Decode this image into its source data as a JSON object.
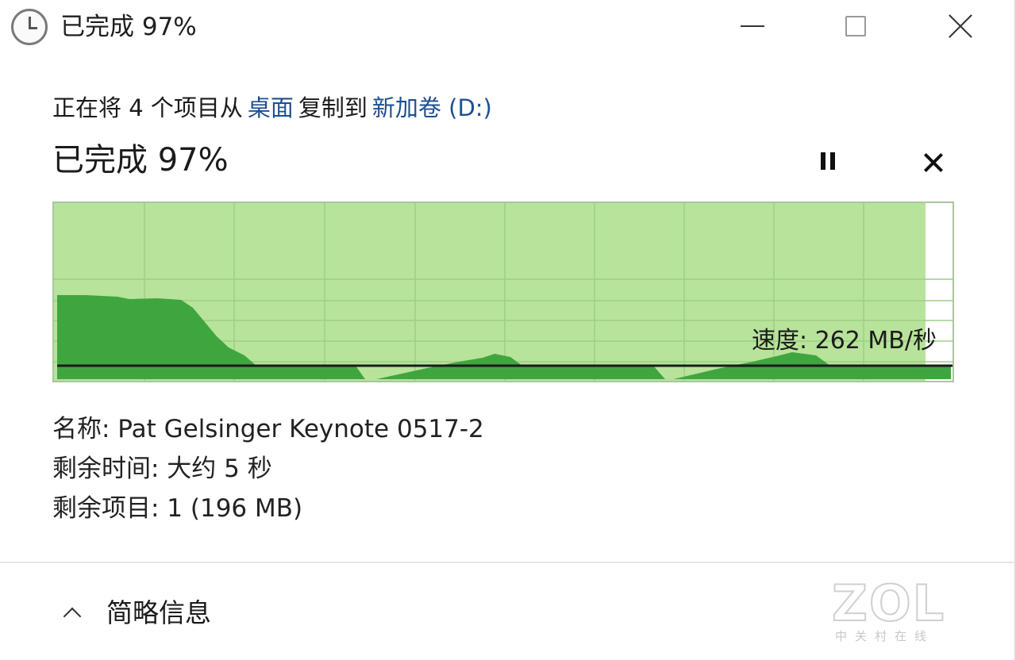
{
  "window": {
    "title": "已完成 97%",
    "minimize_icon": "minimize-icon",
    "maximize_icon": "maximize-icon",
    "close_icon": "close-icon",
    "title_icon": "clock-icon"
  },
  "copy": {
    "prefix": "正在将 4 个项目从",
    "source": "桌面",
    "middle": "复制到",
    "destination": "新加卷 (D:)",
    "link_color": "#1e4f8f"
  },
  "progress": {
    "heading": "已完成 97%",
    "percent": 97,
    "pause_icon": "pause-icon",
    "cancel_icon": "cancel-icon"
  },
  "graph": {
    "speed_label": "速度: 262 MB/秒",
    "fill_color": "#b8e39a",
    "history_color": "#3fa63f",
    "grid_color": "#9ccf86",
    "speed_line_color": "#1a1a1a"
  },
  "details": {
    "name": "名称: Pat Gelsinger Keynote 0517-2",
    "time_left": "剩余时间: 大约 5 秒",
    "items_left": "剩余项目: 1 (196 MB)"
  },
  "footer": {
    "toggle_label": "简略信息",
    "toggle_icon": "chevron-up-icon"
  },
  "watermark": {
    "logo": "ZOL",
    "sub": "中关村在线"
  }
}
